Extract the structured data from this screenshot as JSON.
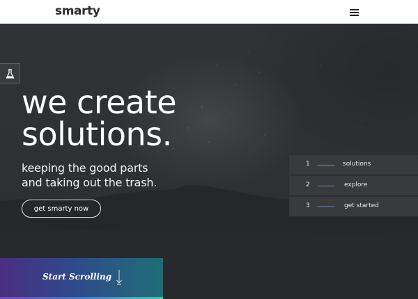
{
  "header": {
    "logo": "smarty",
    "menu_icon": "hamburger-menu-icon"
  },
  "hero": {
    "side_tab_icon": "flask-icon",
    "headline_line1": "we create",
    "headline_line2": "solutions.",
    "subline_line1": "keeping the good parts",
    "subline_line2": "and taking out the trash.",
    "cta_label": "get smarty now"
  },
  "steps": [
    {
      "number": "1",
      "label": "solutions"
    },
    {
      "number": "2",
      "label": "explore"
    },
    {
      "number": "3",
      "label": "get started"
    }
  ],
  "scroll": {
    "label": "Start Scrolling",
    "icon": "arrow-down-icon"
  },
  "colors": {
    "background": "#2c2d30",
    "header_bg": "#ffffff",
    "accent_line": "#6f8fb3",
    "scroll_gradient_start": "#4a2e82",
    "scroll_gradient_end": "#1f6e78"
  }
}
